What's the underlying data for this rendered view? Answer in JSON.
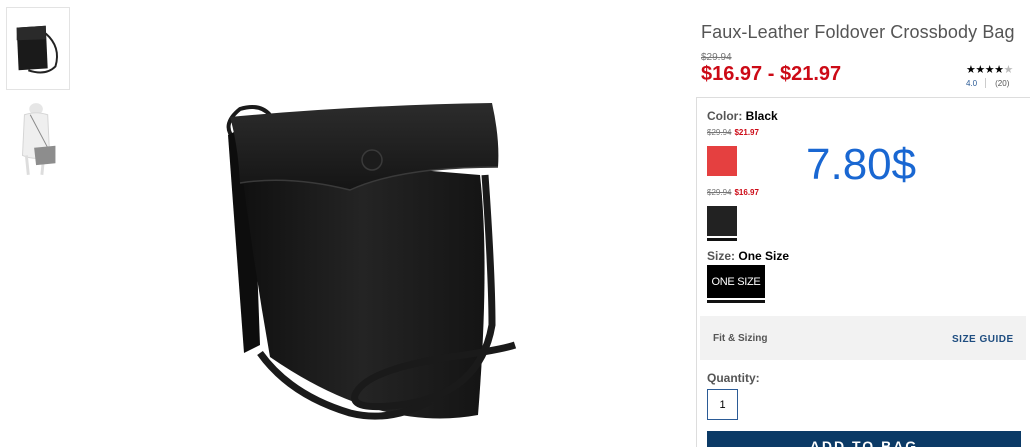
{
  "gallery": {
    "thumbnails": [
      {
        "alt": "bag-front",
        "active": true
      },
      {
        "alt": "bag-on-model",
        "active": false
      }
    ]
  },
  "product": {
    "title": "Faux-Leather Foldover Crossbody Bag",
    "original_price": "$29.94",
    "sale_range": "$16.97 - $21.97",
    "rating": {
      "stars_filled": "★★★★",
      "stars_empty": "★",
      "value": "4.0",
      "count": "(20)"
    }
  },
  "color": {
    "label": "Color:",
    "selected": "Black",
    "swatches": [
      {
        "name": "red",
        "hex": "#e54040",
        "was": "$29.94",
        "now": "$21.97"
      },
      {
        "name": "black",
        "hex": "#222222",
        "was": "$29.94",
        "now": "$16.97"
      }
    ]
  },
  "overlay_price": "7.80$",
  "size": {
    "label": "Size:",
    "selected": "One Size",
    "option": "ONE SIZE"
  },
  "fit": {
    "label": "Fit & Sizing",
    "guide_link": "SIZE GUIDE"
  },
  "quantity": {
    "label": "Quantity:",
    "value": "1"
  },
  "cta": {
    "add_to_bag": "ADD TO BAG"
  },
  "colors": {
    "sale_red": "#cc0a16",
    "cta_navy": "#0b3a66",
    "overlay_blue": "#1967d2",
    "link_blue": "#1e4d80"
  }
}
